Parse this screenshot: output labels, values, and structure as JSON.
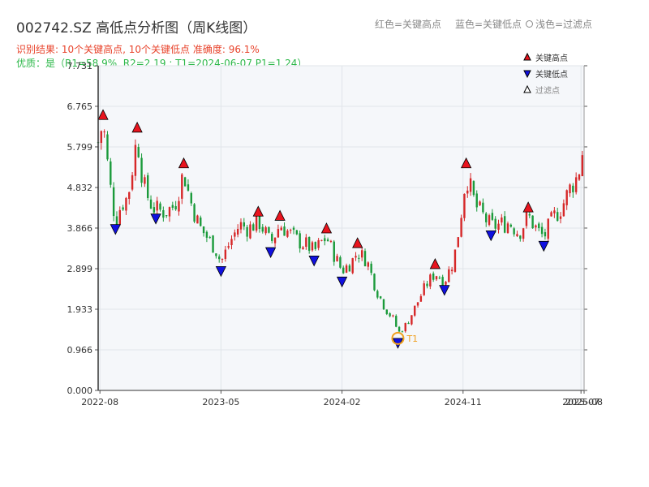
{
  "header": {
    "title": "002742.SZ 高低点分析图（周K线图）",
    "legend_red": "红色=关键高点",
    "legend_blue": "蓝色=关键低点",
    "legend_filtered": "浅色=过滤点",
    "result_line": "识别结果: 10个关键高点, 10个关键低点   准确度: 96.1%",
    "quality_line": "优质：是（R1=58.9%, R2=2.19 ; T1=2024-06-07 P1=1.24）"
  },
  "colors": {
    "up": "#d62728",
    "down": "#1a9a3a",
    "high_marker": "#e8141e",
    "low_marker": "#1010e0",
    "t1_ring": "#f0a020",
    "plot_bg": "#f5f7fa"
  },
  "chart_data": {
    "type": "candlestick",
    "ylim": [
      0,
      7.731
    ],
    "yticks": [
      "0.000",
      "0.966",
      "1.933",
      "2.899",
      "3.866",
      "4.832",
      "5.799",
      "6.765",
      "7.731"
    ],
    "ytick_values": [
      0,
      0.966,
      1.933,
      2.899,
      3.866,
      4.832,
      5.799,
      6.765,
      7.731
    ],
    "xticks": [
      "2022-08",
      "2023-05",
      "2024-02",
      "2024-11",
      "2025-07",
      "2025-08"
    ],
    "xtick_dates": [
      "2022-08-05",
      "2023-05-05",
      "2024-02-02",
      "2024-11-01",
      "2025-07-25",
      "2025-08-01"
    ],
    "date_range": [
      "2022-08-01",
      "2025-08-01"
    ],
    "legend": {
      "high": "关键高点",
      "low": "关键低点",
      "filtered": "过滤点"
    },
    "key_highs": [
      {
        "date": "2022-08-12",
        "value": 6.45
      },
      {
        "date": "2022-10-28",
        "value": 6.15
      },
      {
        "date": "2023-02-10",
        "value": 5.3
      },
      {
        "date": "2023-07-28",
        "value": 4.15
      },
      {
        "date": "2023-09-15",
        "value": 4.05
      },
      {
        "date": "2023-12-29",
        "value": 3.75
      },
      {
        "date": "2024-03-08",
        "value": 3.4
      },
      {
        "date": "2024-08-30",
        "value": 2.9
      },
      {
        "date": "2024-11-08",
        "value": 5.3
      },
      {
        "date": "2025-03-28",
        "value": 4.25
      }
    ],
    "key_lows": [
      {
        "date": "2022-09-09",
        "value": 3.95
      },
      {
        "date": "2022-12-09",
        "value": 4.2
      },
      {
        "date": "2023-05-05",
        "value": 2.95
      },
      {
        "date": "2023-08-25",
        "value": 3.4
      },
      {
        "date": "2023-12-01",
        "value": 3.2
      },
      {
        "date": "2024-02-02",
        "value": 2.7
      },
      {
        "date": "2024-06-07",
        "value": 1.24
      },
      {
        "date": "2024-09-20",
        "value": 2.5
      },
      {
        "date": "2025-01-03",
        "value": 3.8
      },
      {
        "date": "2025-05-02",
        "value": 3.55
      }
    ],
    "t1": {
      "label": "T1",
      "date": "2024-06-07",
      "value": 1.24
    },
    "weekly_path": [
      [
        "2022-08-01",
        5.9
      ],
      [
        "2022-08-12",
        6.4
      ],
      [
        "2022-08-26",
        5.0
      ],
      [
        "2022-09-09",
        4.05
      ],
      [
        "2022-09-23",
        4.45
      ],
      [
        "2022-10-07",
        4.6
      ],
      [
        "2022-10-28",
        6.05
      ],
      [
        "2022-11-11",
        4.9
      ],
      [
        "2022-11-25",
        4.5
      ],
      [
        "2022-12-09",
        4.3
      ],
      [
        "2022-12-30",
        4.25
      ],
      [
        "2023-01-20",
        4.4
      ],
      [
        "2023-02-10",
        5.2
      ],
      [
        "2023-02-24",
        4.55
      ],
      [
        "2023-03-17",
        3.9
      ],
      [
        "2023-04-07",
        3.6
      ],
      [
        "2023-04-21",
        3.4
      ],
      [
        "2023-05-05",
        3.05
      ],
      [
        "2023-05-26",
        3.55
      ],
      [
        "2023-06-16",
        3.95
      ],
      [
        "2023-07-07",
        3.85
      ],
      [
        "2023-07-28",
        4.05
      ],
      [
        "2023-08-11",
        3.8
      ],
      [
        "2023-08-25",
        3.5
      ],
      [
        "2023-09-15",
        3.95
      ],
      [
        "2023-10-06",
        3.75
      ],
      [
        "2023-10-27",
        3.55
      ],
      [
        "2023-11-17",
        3.45
      ],
      [
        "2023-12-01",
        3.3
      ],
      [
        "2023-12-15",
        3.5
      ],
      [
        "2023-12-29",
        3.65
      ],
      [
        "2024-01-12",
        3.3
      ],
      [
        "2024-02-02",
        2.85
      ],
      [
        "2024-02-23",
        3.05
      ],
      [
        "2024-03-08",
        3.3
      ],
      [
        "2024-03-29",
        3.1
      ],
      [
        "2024-04-19",
        2.4
      ],
      [
        "2024-05-10",
        1.95
      ],
      [
        "2024-05-31",
        1.65
      ],
      [
        "2024-06-07",
        1.35
      ],
      [
        "2024-06-28",
        1.6
      ],
      [
        "2024-07-19",
        2.05
      ],
      [
        "2024-08-09",
        2.5
      ],
      [
        "2024-08-30",
        2.8
      ],
      [
        "2024-09-20",
        2.6
      ],
      [
        "2024-10-11",
        3.1
      ],
      [
        "2024-10-25",
        4.0
      ],
      [
        "2024-11-08",
        5.15
      ],
      [
        "2024-11-29",
        4.4
      ],
      [
        "2024-12-20",
        4.1
      ],
      [
        "2025-01-03",
        3.9
      ],
      [
        "2025-01-24",
        3.95
      ],
      [
        "2025-02-14",
        4.0
      ],
      [
        "2025-03-07",
        3.75
      ],
      [
        "2025-03-28",
        4.15
      ],
      [
        "2025-04-18",
        3.8
      ],
      [
        "2025-05-02",
        3.65
      ],
      [
        "2025-05-23",
        4.1
      ],
      [
        "2025-06-13",
        4.4
      ],
      [
        "2025-07-04",
        4.9
      ],
      [
        "2025-07-18",
        5.1
      ],
      [
        "2025-08-01",
        5.9
      ]
    ]
  }
}
